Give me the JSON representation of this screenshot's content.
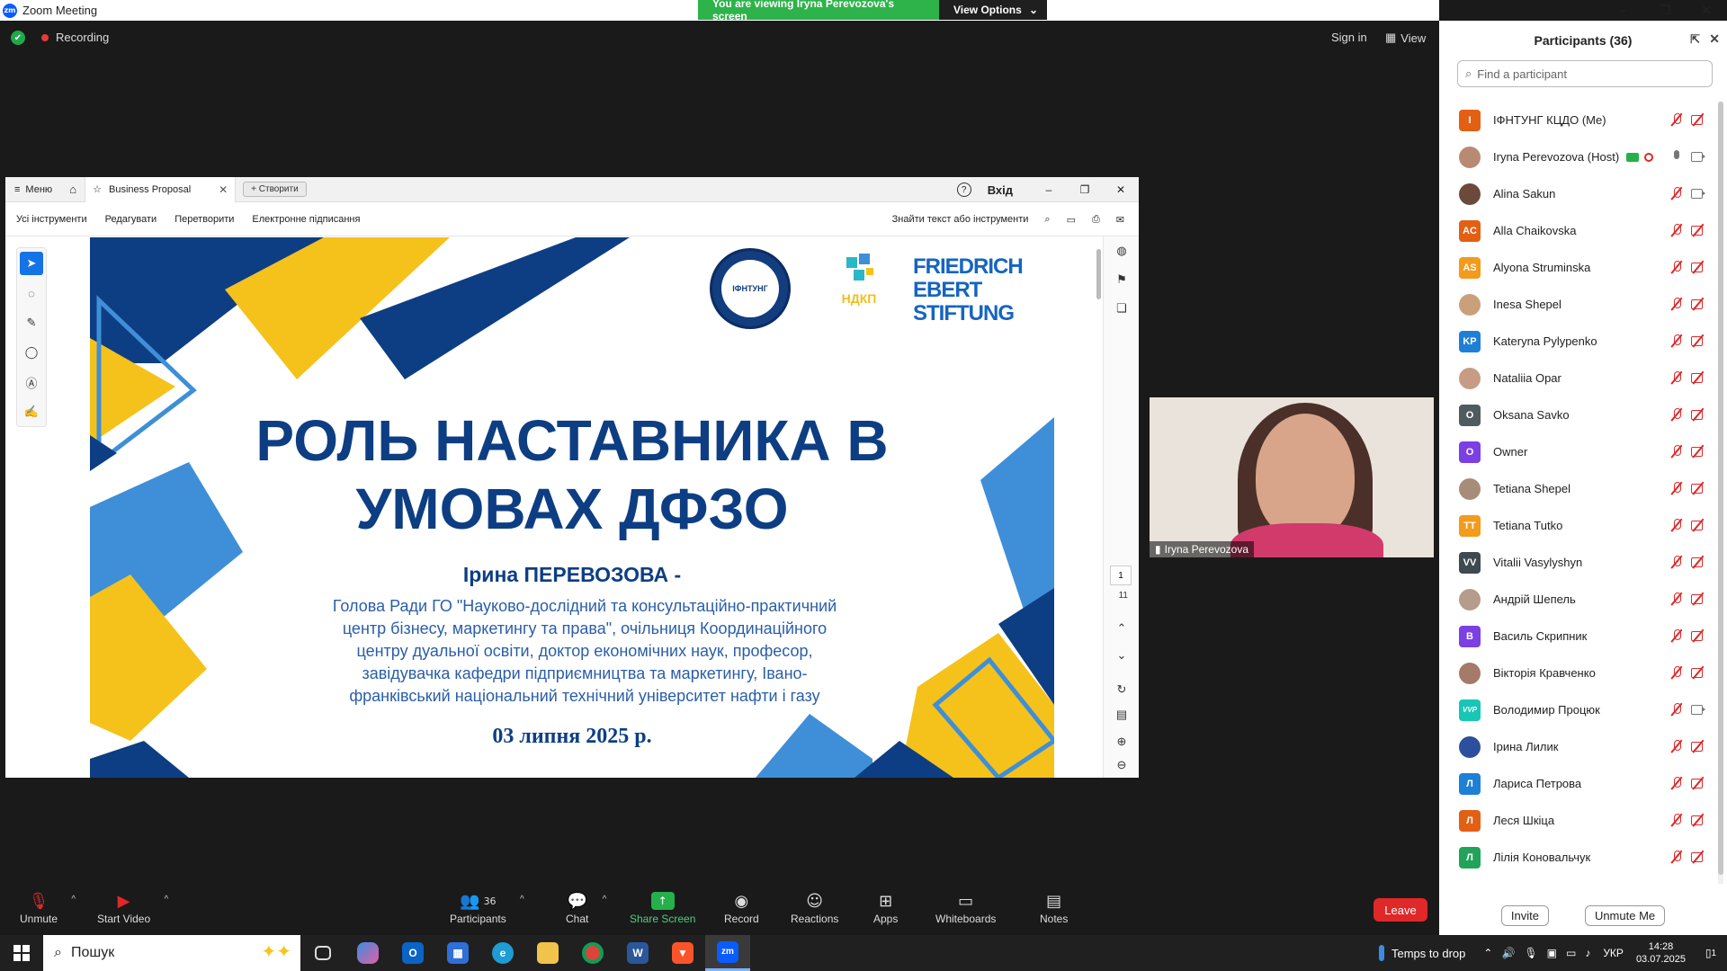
{
  "window": {
    "title": "Zoom Meeting",
    "logo": "zm"
  },
  "banner": {
    "viewing": "You are viewing Iryna Perevozova's screen",
    "view_options": "View Options"
  },
  "recording": {
    "label": "Recording"
  },
  "topright": {
    "sign_in": "Sign in",
    "view": "View"
  },
  "pdf": {
    "menu": "Меню",
    "tab_title": "Business Proposal",
    "create": "Створити",
    "login": "Вхід",
    "toolbar": [
      "Усі інструменти",
      "Редагувати",
      "Перетворити",
      "Електронне підписання"
    ],
    "search_text": "Знайти текст або інструменти",
    "page_current": "1",
    "page_total": "11"
  },
  "slide": {
    "title_line1": "РОЛЬ НАСТАВНИКА В",
    "title_line2": "УМОВАХ ДФЗО",
    "presenter": "Ірина ПЕРЕВОЗОВА -",
    "desc_lines": [
      "Голова Ради ГО \"Науково-дослідний та консультаційно-практичний",
      "центр бізнесу, маркетингу та права\", очільниця Координаційного",
      "центру дуальної освіти, доктор економічних наук, професор,",
      "завідувачка кафедри підприємництва та маркетингу, Івано-",
      "франківський національний технічний університет нафти і газу"
    ],
    "date": "03 липня 2025 р.",
    "logo_emblem": "ІФНТУНГ",
    "logo_ndkp": "НДКП",
    "logo_fes": [
      "FRIEDRICH",
      "EBERT",
      "STIFTUNG"
    ],
    "colors": {
      "navy": "#0d3e83",
      "yellow": "#f5c21b",
      "light_blue": "#3e8fd8"
    }
  },
  "speaker": {
    "name": "Iryna Perevozova"
  },
  "toolbar": {
    "unmute": "Unmute",
    "start_video": "Start Video",
    "participants": "Participants",
    "participants_count": "36",
    "chat": "Chat",
    "share_screen": "Share Screen",
    "record": "Record",
    "reactions": "Reactions",
    "apps": "Apps",
    "whiteboards": "Whiteboards",
    "notes": "Notes",
    "leave": "Leave"
  },
  "participants_panel": {
    "title": "Participants (36)",
    "search_placeholder": "Find a participant",
    "invite": "Invite",
    "unmute_me": "Unmute Me",
    "items": [
      {
        "name": "ІФНТУНГ КЦДО (Me)",
        "initials": "І",
        "color": "#e35f14",
        "cam": "off"
      },
      {
        "name": "Iryna Perevozova (Host)",
        "initials": "",
        "color": "#b88a73",
        "cam": "on",
        "host": true
      },
      {
        "name": "Alina Sakun",
        "initials": "",
        "color": "#6b4a3a",
        "cam": "on"
      },
      {
        "name": "Alla Chaikovska",
        "initials": "AC",
        "color": "#e35f14",
        "cam": "off"
      },
      {
        "name": "Alyona Struminska",
        "initials": "AS",
        "color": "#f29b1d",
        "cam": "off"
      },
      {
        "name": "Inesa Shepel",
        "initials": "",
        "color": "#c9a07a",
        "cam": "off"
      },
      {
        "name": "Kateryna Pylypenko",
        "initials": "KP",
        "color": "#1d7fd6",
        "cam": "off"
      },
      {
        "name": "Nataliia Opar",
        "initials": "",
        "color": "#c79b84",
        "cam": "off"
      },
      {
        "name": "Oksana Savko",
        "initials": "O",
        "color": "#4f5b5f",
        "cam": "off"
      },
      {
        "name": "Owner",
        "initials": "O",
        "color": "#7b3fe4",
        "cam": "off"
      },
      {
        "name": "Tetiana Shepel",
        "initials": "",
        "color": "#a88c7a",
        "cam": "off"
      },
      {
        "name": "Tetiana Tutko",
        "initials": "TT",
        "color": "#f29b1d",
        "cam": "off"
      },
      {
        "name": "Vitalii Vasylyshyn",
        "initials": "VV",
        "color": "#3e4a50",
        "cam": "off"
      },
      {
        "name": "Андрій Шепель",
        "initials": "",
        "color": "#b59c8c",
        "cam": "off"
      },
      {
        "name": "Василь Скрипник",
        "initials": "В",
        "color": "#7b3fe4",
        "cam": "off"
      },
      {
        "name": "Вікторія Кравченко",
        "initials": "",
        "color": "#a67a68",
        "cam": "off"
      },
      {
        "name": "Володимир Процюк",
        "initials": "VVP",
        "color": "#18c6b6",
        "cam": "on"
      },
      {
        "name": "Ірина Лилик",
        "initials": "",
        "color": "#2c4f9e",
        "cam": "off"
      },
      {
        "name": "Лариса Петрова",
        "initials": "Л",
        "color": "#1d7fd6",
        "cam": "off"
      },
      {
        "name": "Леся Шкіца",
        "initials": "Л",
        "color": "#e35f14",
        "cam": "off"
      },
      {
        "name": "Лілія Коновальчук",
        "initials": "Л",
        "color": "#22a35a",
        "cam": "off"
      }
    ]
  },
  "taskbar": {
    "search": "Пошук",
    "temps": "Temps to drop",
    "lang": "УКР",
    "time": "14:28",
    "date": "03.07.2025",
    "notif_count": "1"
  }
}
